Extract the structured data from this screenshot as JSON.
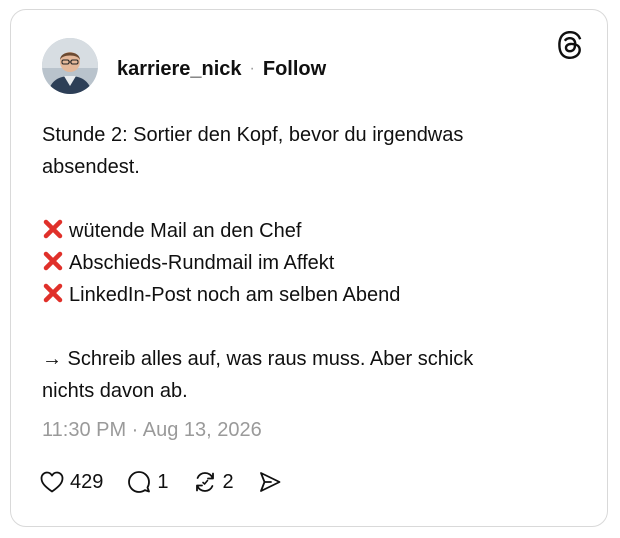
{
  "post": {
    "username": "karriere_nick",
    "separator": "·",
    "follow_label": "Follow",
    "intro_line1": "Stunde 2: Sortier den Kopf, bevor du irgendwas",
    "intro_line2": "absendest.",
    "bullets": [
      "wütende Mail an den Chef",
      "Abschieds-Rundmail im Affekt",
      "LinkedIn-Post noch am selben Abend"
    ],
    "closing_line1": "→ Schreib alles auf, was raus muss. Aber schick",
    "closing_line2": "nichts davon ab.",
    "timestamp": "11:30 PM · Aug 13, 2026"
  },
  "actions": {
    "likes": "429",
    "replies": "1",
    "reposts": "2"
  },
  "icons": {
    "bullet": "cross-mark-icon",
    "like": "heart-icon",
    "reply": "speech-bubble-icon",
    "repost": "repost-icon",
    "share": "send-icon",
    "brand": "threads-logo-icon"
  },
  "colors": {
    "text": "#101010",
    "muted": "#9a9a9a",
    "cross": "#e0302a",
    "border": "#d9d9d9"
  }
}
